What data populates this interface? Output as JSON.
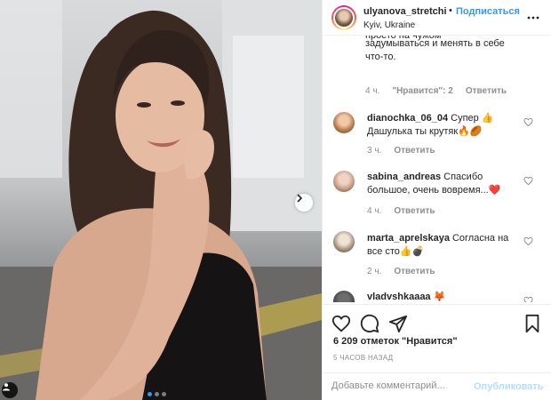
{
  "post": {
    "header": {
      "username": "ulyanova_stretching",
      "separator": "•",
      "follow_label": "Подписаться",
      "location": "Kyiv, Ukraine"
    },
    "comments": {
      "top_partial": {
        "text_cut": "просто на чужом",
        "line1": "задумываться и менять в себе",
        "line2": "что-то.",
        "time": "4 ч.",
        "likes": "\"Нравится\": 2",
        "reply": "Ответить"
      },
      "items": [
        {
          "username": "dianochka_06_04",
          "line1": "Супер 👍",
          "line2": "Дашулька ты крутяк🔥🏉",
          "time": "3 ч.",
          "reply": "Ответить"
        },
        {
          "username": "sabina_andreas",
          "line1": "Спасибо",
          "line2": "большое, очень вовремя...❤️",
          "time": "4 ч.",
          "reply": "Ответить"
        },
        {
          "username": "marta_aprelskaya",
          "line1": "Согласна на",
          "line2": "все сто👍💣",
          "time": "2 ч.",
          "reply": "Ответить"
        },
        {
          "username": "vladvshkaaaa",
          "line1": "🦊",
          "line2": "",
          "time": "",
          "reply": ""
        }
      ]
    },
    "likes_text": "6 209 отметок \"Нравится\"",
    "time_ago": "5 ЧАСОВ НАЗАД",
    "comment_input": {
      "placeholder": "Добавьте комментарий...",
      "value": ""
    },
    "publish_label": "Опубликовать",
    "carousel": {
      "slides": 3,
      "active": 0
    },
    "icons": [
      "more-icon",
      "next-arrow-icon",
      "user-tag-icon",
      "heart-icon",
      "comment-icon",
      "share-icon",
      "bookmark-icon"
    ],
    "colors": {
      "accent": "#3897f0",
      "publish_disabled": "#b2dffc",
      "text": "#262626",
      "muted": "#8e8e8e"
    }
  }
}
